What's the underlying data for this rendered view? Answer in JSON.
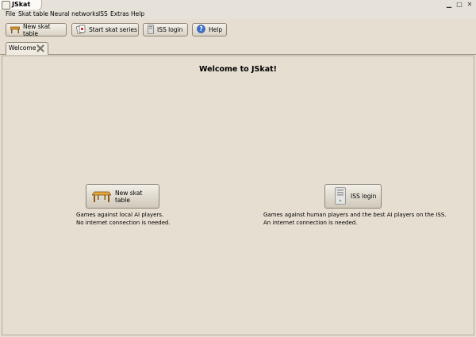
{
  "window": {
    "title": "JSkat",
    "min": "▁",
    "max": "□",
    "close": "✕"
  },
  "menu": [
    "File",
    "Skat table",
    "Neural networks",
    "ISS",
    "Extras",
    "Help"
  ],
  "toolbar": {
    "new_table": "New skat table",
    "series": "Start skat series",
    "iss_login": "ISS login",
    "help": "Help"
  },
  "tabs": [
    {
      "label": "Welcome"
    }
  ],
  "welcome": {
    "title": "Welcome to JSkat!",
    "local": {
      "button": "New skat table",
      "line1": "Games against local AI players.",
      "line2": "No internet connection is needed."
    },
    "iss": {
      "button": "ISS login",
      "line1": "Games against human players and the best AI players on the ISS.",
      "line2": "An internet connection is needed."
    }
  }
}
